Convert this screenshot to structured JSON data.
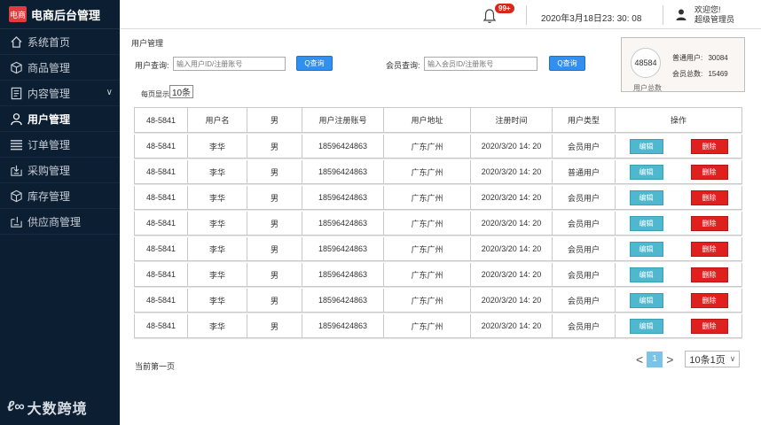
{
  "brand": {
    "logo_text": "电商",
    "title": "电商后台管理"
  },
  "nav": {
    "items": [
      {
        "label": "系统首页",
        "icon": "home-icon"
      },
      {
        "label": "商品管理",
        "icon": "cube-icon"
      },
      {
        "label": "内容管理",
        "icon": "document-icon",
        "chevron": "∨"
      },
      {
        "label": "用户管理",
        "icon": "user-icon",
        "active": true
      },
      {
        "label": "订单管理",
        "icon": "list-icon"
      },
      {
        "label": "采购管理",
        "icon": "purchase-icon"
      },
      {
        "label": "库存管理",
        "icon": "cube-icon"
      },
      {
        "label": "供应商管理",
        "icon": "supplier-icon"
      }
    ],
    "footer_logo_mark": "ℓ∞",
    "footer_logo_text": "大数跨境"
  },
  "header": {
    "badge": "99+",
    "datetime": "2020年3月18日23: 30: 08",
    "welcome_line1": "欢迎您!",
    "welcome_line2": "超级管理员"
  },
  "page": {
    "breadcrumb": "用户管理",
    "user_search_label": "用户查询:",
    "user_search_placeholder": "输入用户ID/注册账号",
    "member_search_label": "会员查询:",
    "member_search_placeholder": "输入会员ID/注册账号",
    "search_button": "Q查询",
    "per_page_label": "每页显示",
    "per_page_value": "10条"
  },
  "stats": {
    "total": "48584",
    "total_caption": "用户总数",
    "normal_label": "普通用户:",
    "normal_value": "30084",
    "member_label": "会员总数:",
    "member_value": "15469"
  },
  "table": {
    "headers": [
      "48-5841",
      "用户名",
      "男",
      "用户注册账号",
      "用户地址",
      "注册时间",
      "用户类型",
      "操作"
    ],
    "edit_label": "编辑",
    "delete_label": "删除",
    "rows": [
      [
        "48-5841",
        "李华",
        "男",
        "18596424863",
        "广东广州",
        "2020/3/20 14: 20",
        "会员用户"
      ],
      [
        "48-5841",
        "李华",
        "男",
        "18596424863",
        "广东广州",
        "2020/3/20 14: 20",
        "普通用户"
      ],
      [
        "48-5841",
        "李华",
        "男",
        "18596424863",
        "广东广州",
        "2020/3/20 14: 20",
        "会员用户"
      ],
      [
        "48-5841",
        "李华",
        "男",
        "18596424863",
        "广东广州",
        "2020/3/20 14: 20",
        "会员用户"
      ],
      [
        "48-5841",
        "李华",
        "男",
        "18596424863",
        "广东广州",
        "2020/3/20 14: 20",
        "会员用户"
      ],
      [
        "48-5841",
        "李华",
        "男",
        "18596424863",
        "广东广州",
        "2020/3/20 14: 20",
        "会员用户"
      ],
      [
        "48-5841",
        "李华",
        "男",
        "18596424863",
        "广东广州",
        "2020/3/20 14: 20",
        "会员用户"
      ],
      [
        "48-5841",
        "李华",
        "男",
        "18596424863",
        "广东广州",
        "2020/3/20 14: 20",
        "会员用户"
      ]
    ]
  },
  "footer": {
    "current_page": "当前第一页",
    "prev": "<",
    "next": ">",
    "current_page_num": "1",
    "page_size_select": "10条1页",
    "select_chevron": "∨"
  },
  "colors": {
    "sidebar_bg": "#0c1e32",
    "search_button": "#2f8ff2",
    "edit_button": "#4fb8cf",
    "delete_button": "#e01f1f",
    "badge": "#d9261c"
  }
}
